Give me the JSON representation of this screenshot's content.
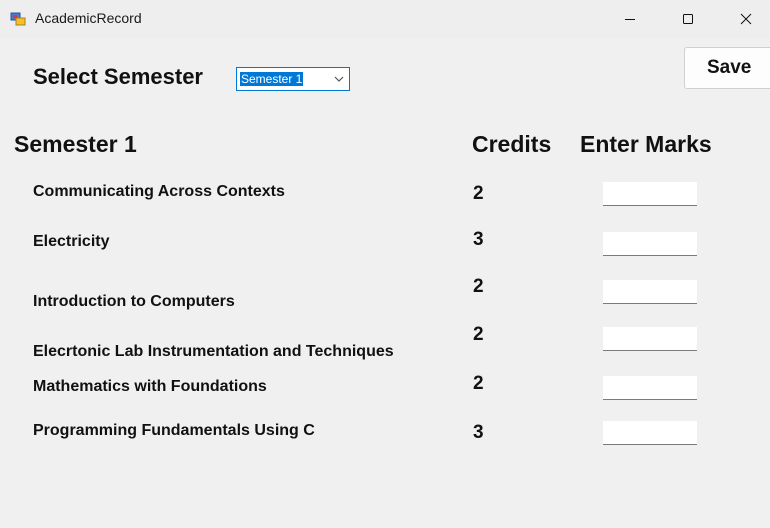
{
  "window": {
    "title": "AcademicRecord",
    "buttons": [
      "minimize",
      "maximize",
      "close"
    ]
  },
  "form": {
    "select_label": "Select Semester",
    "semester_dropdown": {
      "selected": "Semester 1"
    },
    "save_label": "Save"
  },
  "table": {
    "heading": "Semester 1",
    "credits_header": "Credits",
    "marks_header": "Enter Marks",
    "courses": [
      {
        "name": "Communicating Across Contexts",
        "credits": "2",
        "marks": ""
      },
      {
        "name": "Electricity",
        "credits": "3",
        "marks": ""
      },
      {
        "name": "Introduction to Computers",
        "credits": "2",
        "marks": ""
      },
      {
        "name": "Elecrtonic Lab Instrumentation and Techniques",
        "credits": "2",
        "marks": ""
      },
      {
        "name": "Mathematics with Foundations",
        "credits": "2",
        "marks": ""
      },
      {
        "name": "Programming Fundamentals Using C",
        "credits": "3",
        "marks": ""
      }
    ]
  },
  "icons": {
    "app": "app-icon",
    "minimize": "minimize-icon",
    "maximize": "maximize-icon",
    "close": "close-icon",
    "dropdown": "chevron-down-icon"
  },
  "colors": {
    "accent": "#0078d7",
    "background": "#f0f0f0"
  }
}
